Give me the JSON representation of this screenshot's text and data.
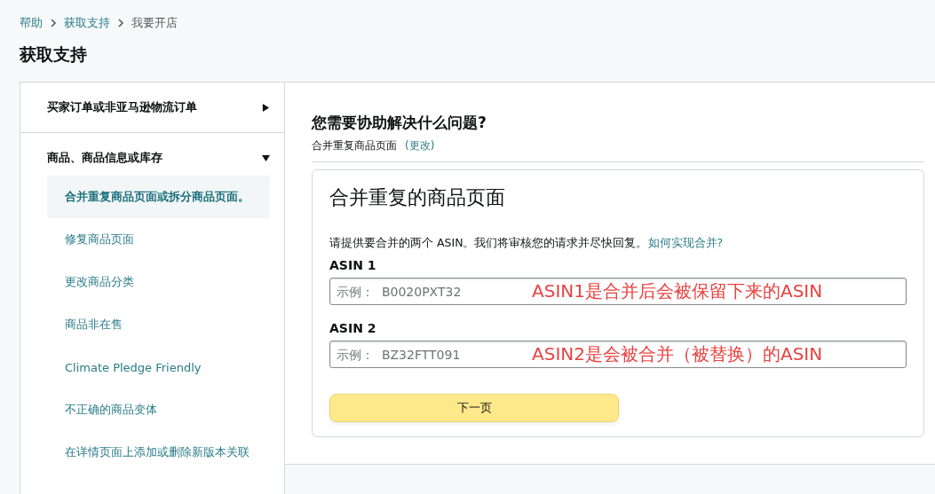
{
  "breadcrumb": [
    {
      "label": "帮助",
      "link": true
    },
    {
      "label": "获取支持",
      "link": true
    },
    {
      "label": "我要开店",
      "link": false
    }
  ],
  "page_title": "获取支持",
  "sidebar": {
    "sections": [
      {
        "label": "买家订单或非亚马逊物流订单",
        "expanded": false
      },
      {
        "label": "商品、商品信息或库存",
        "expanded": true,
        "children": [
          {
            "label": "合并重复商品页面或拆分商品页面。",
            "selected": true
          },
          {
            "label": "修复商品页面",
            "selected": false
          },
          {
            "label": "更改商品分类",
            "selected": false
          },
          {
            "label": "商品非在售",
            "selected": false
          },
          {
            "label": "Climate Pledge Friendly",
            "selected": false
          },
          {
            "label": "不正确的商品变体",
            "selected": false
          },
          {
            "label": "在详情页面上添加或删除新版本关联",
            "selected": false
          }
        ]
      }
    ]
  },
  "question": {
    "title": "您需要协助解决什么问题?",
    "current": "合并重复商品页面",
    "change_link": "(更改)"
  },
  "form": {
    "title": "合并重复的商品页面",
    "description": "请提供要合并的两个 ASIN。我们将审核您的请求并尽快回复。",
    "help_link": "如何实现合并?",
    "fields": [
      {
        "label": "ASIN 1",
        "placeholder": "示例：  B0020PXT32",
        "annotation": "ASIN1是合并后会被保留下来的ASIN"
      },
      {
        "label": "ASIN 2",
        "placeholder": "示例：  BZ32FTT091",
        "annotation": "ASIN2是会被合并（被替换）的ASIN"
      }
    ],
    "button": "下一页"
  }
}
